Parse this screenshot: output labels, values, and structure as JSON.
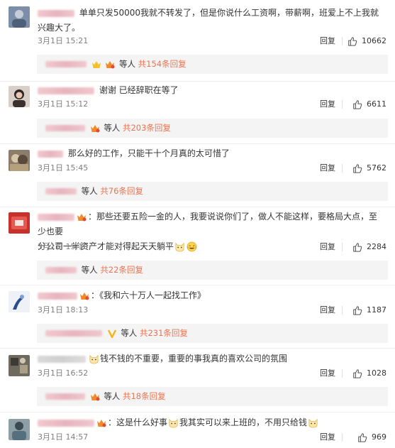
{
  "comments": [
    {
      "text": "单单只发50000我就不转发了，但是你说什么工资啊，带薪啊，班爱上不上我就兴趣大了。",
      "time": "3月1日 15:21",
      "reply_label": "回复",
      "likes": "10662",
      "sub_text": "等人",
      "sub_count": "共154条回复"
    },
    {
      "text": "谢谢 已经辞职在等了",
      "time": "3月1日 15:12",
      "reply_label": "回复",
      "likes": "6611",
      "sub_text": "等人",
      "sub_count": "共203条回复"
    },
    {
      "text": "那么好的工作，只能干十个月真的太可惜了",
      "time": "3月1日 15:45",
      "reply_label": "回复",
      "likes": "5762",
      "sub_text": "等人",
      "sub_count": "共76条回复"
    },
    {
      "text_a": "：那些还要五险一金的人，我要说说你们了，做人不能这样，要格局大点，至少也要",
      "text_b": "分公司一半资产才能对得起天天躺平",
      "time": "3月1日 15:10",
      "reply_label": "回复",
      "likes": "2284",
      "sub_text": "等人",
      "sub_count": "共22条回复"
    },
    {
      "text": "：《我和六十万人一起找工作》",
      "time": "3月1日 18:13",
      "reply_label": "回复",
      "likes": "1187",
      "sub_text": "等人",
      "sub_count": "共231条回复"
    },
    {
      "text": "钱不钱的不重要，重要的事我真的喜欢公司的氛围",
      "time": "3月1日 16:52",
      "reply_label": "回复",
      "likes": "1028",
      "sub_text": "等人",
      "sub_count": "共18条回复"
    },
    {
      "text_a": "：这是什么好事",
      "text_b": "我其实可以来上班的，不用只给钱",
      "time": "3月1日 14:57",
      "reply_label": "回复",
      "likes": "969"
    }
  ],
  "colors": {
    "count_link": "#eb7350",
    "meta_gray": "#808080",
    "sub_bg": "#f4f4f4",
    "divider": "#efefef"
  },
  "icons": {
    "like": "thumbs-up-icon",
    "vip": "crown-badge-icon",
    "emoji_cat": "cat-face-emoji",
    "emoji_laugh": "laughing-emoji"
  }
}
